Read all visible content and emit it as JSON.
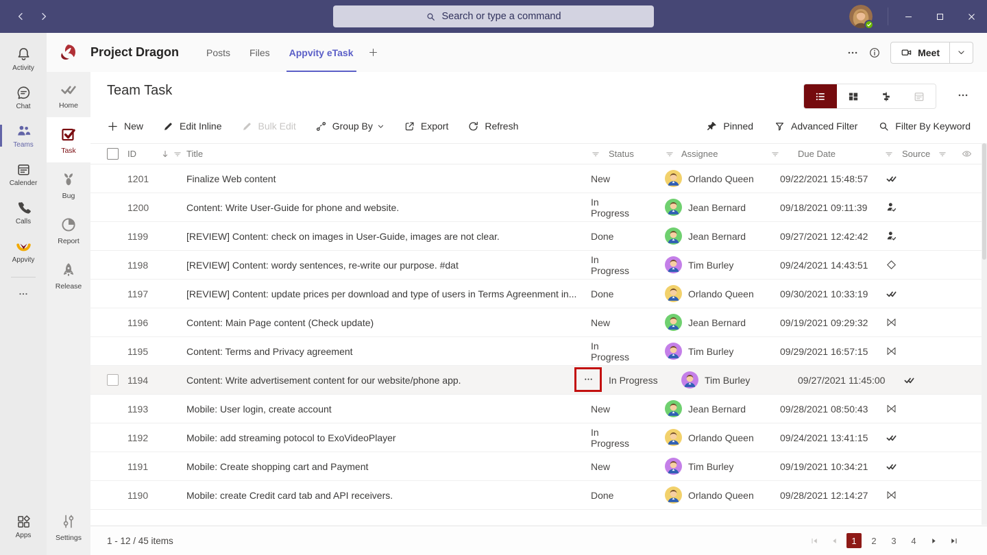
{
  "colors": {
    "topbar": "#464775",
    "teams_accent": "#6264a7",
    "tab_accent": "#5b5fc7",
    "brand_maroon": "#750b0e",
    "pagination_active": "#8e1a17",
    "annotation_red": "#c3100f",
    "presence_green": "#6bb700",
    "avatar_orlando": "#f2d16b",
    "avatar_jean": "#6fd06f",
    "avatar_tim": "#c47fe8"
  },
  "titlebar": {
    "search_placeholder": "Search or type a command"
  },
  "app_rail": {
    "items": [
      {
        "label": "Activity"
      },
      {
        "label": "Chat"
      },
      {
        "label": "Teams"
      },
      {
        "label": "Calender"
      },
      {
        "label": "Calls"
      },
      {
        "label": "Appvity"
      }
    ],
    "apps_label": "Apps"
  },
  "channel_header": {
    "team_name": "Project Dragon",
    "tabs": [
      {
        "label": "Posts"
      },
      {
        "label": "Files"
      },
      {
        "label": "Appvity eTask"
      }
    ],
    "meet_label": "Meet"
  },
  "side_nav": {
    "items": [
      {
        "label": "Home"
      },
      {
        "label": "Task"
      },
      {
        "label": "Bug"
      },
      {
        "label": "Report"
      },
      {
        "label": "Release"
      }
    ],
    "settings_label": "Settings"
  },
  "page": {
    "title": "Team Task"
  },
  "toolbar": {
    "new": "New",
    "edit_inline": "Edit Inline",
    "bulk_edit": "Bulk Edit",
    "group_by": "Group By",
    "export": "Export",
    "refresh": "Refresh",
    "pinned": "Pinned",
    "advanced_filter": "Advanced Filter",
    "filter_by_keyword": "Filter By Keyword"
  },
  "table": {
    "columns": {
      "id": "ID",
      "title": "Title",
      "status": "Status",
      "assignee": "Assignee",
      "due_date": "Due Date",
      "source": "Source"
    },
    "rows": [
      {
        "id": "1201",
        "title": "Finalize Web content",
        "status": "New",
        "assignee": "Orlando Queen",
        "avatar_color": "#f2d16b",
        "due": "09/22/2021 15:48:57",
        "source": "etask",
        "highlighted": false
      },
      {
        "id": "1200",
        "title": "Content: Write User-Guide for phone and website.",
        "status": "In Progress",
        "assignee": "Jean Bernard",
        "avatar_color": "#6fd06f",
        "due": "09/18/2021 09:11:39",
        "source": "person",
        "highlighted": false
      },
      {
        "id": "1199",
        "title": "[REVIEW] Content: check on images in User-Guide, images are not clear.",
        "status": "Done",
        "assignee": "Jean Bernard",
        "avatar_color": "#6fd06f",
        "due": "09/27/2021 12:42:42",
        "source": "person",
        "highlighted": false
      },
      {
        "id": "1198",
        "title": "[REVIEW] Content: wordy sentences, re-write our purpose. #dat",
        "status": "In Progress",
        "assignee": "Tim Burley",
        "avatar_color": "#c47fe8",
        "due": "09/24/2021 14:43:51",
        "source": "diamond",
        "highlighted": false
      },
      {
        "id": "1197",
        "title": "[REVIEW] Content: update prices per download and type of users in Terms Agreenment in...",
        "status": "Done",
        "assignee": "Orlando Queen",
        "avatar_color": "#f2d16b",
        "due": "09/30/2021 10:33:19",
        "source": "etask",
        "highlighted": false
      },
      {
        "id": "1196",
        "title": "Content: Main Page content (Check update)",
        "status": "New",
        "assignee": "Jean Bernard",
        "avatar_color": "#6fd06f",
        "due": "09/19/2021 09:29:32",
        "source": "bowtie",
        "highlighted": false
      },
      {
        "id": "1195",
        "title": "Content: Terms and Privacy agreement",
        "status": "In Progress",
        "assignee": "Tim Burley",
        "avatar_color": "#c47fe8",
        "due": "09/29/2021 16:57:15",
        "source": "bowtie",
        "highlighted": false
      },
      {
        "id": "1194",
        "title": "Content: Write advertisement content for our website/phone app.",
        "status": "In Progress",
        "assignee": "Tim Burley",
        "avatar_color": "#c47fe8",
        "due": "09/27/2021 11:45:00",
        "source": "etask",
        "highlighted": true
      },
      {
        "id": "1193",
        "title": "Mobile: User login, create account",
        "status": "New",
        "assignee": "Jean Bernard",
        "avatar_color": "#6fd06f",
        "due": "09/28/2021 08:50:43",
        "source": "bowtie",
        "highlighted": false
      },
      {
        "id": "1192",
        "title": "Mobile: add streaming potocol to ExoVideoPlayer",
        "status": "In Progress",
        "assignee": "Orlando Queen",
        "avatar_color": "#f2d16b",
        "due": "09/24/2021 13:41:15",
        "source": "etask",
        "highlighted": false
      },
      {
        "id": "1191",
        "title": "Mobile: Create shopping cart and Payment",
        "status": "New",
        "assignee": "Tim Burley",
        "avatar_color": "#c47fe8",
        "due": "09/19/2021 10:34:21",
        "source": "etask",
        "highlighted": false
      },
      {
        "id": "1190",
        "title": "Mobile: create Credit card tab and API receivers.",
        "status": "Done",
        "assignee": "Orlando Queen",
        "avatar_color": "#f2d16b",
        "due": "09/28/2021 12:14:27",
        "source": "bowtie",
        "highlighted": false
      }
    ]
  },
  "footer": {
    "count_text": "1 - 12 / 45 items",
    "pages": [
      "1",
      "2",
      "3",
      "4"
    ],
    "active_page": "1"
  }
}
